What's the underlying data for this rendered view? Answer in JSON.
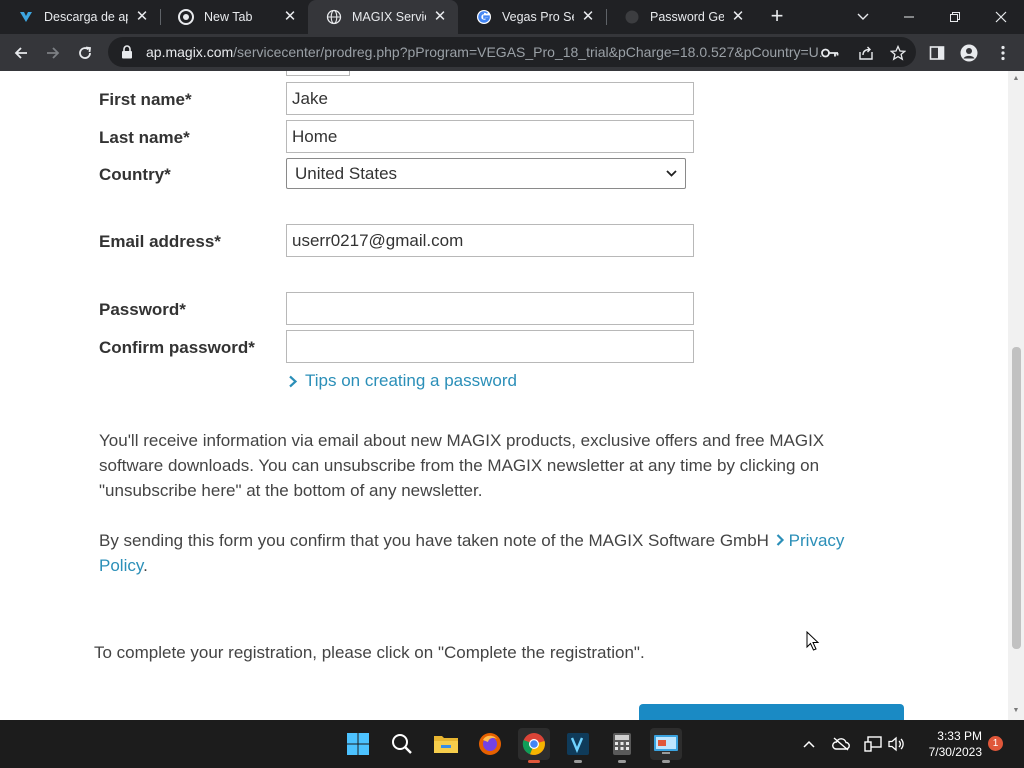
{
  "browser": {
    "tabs": [
      {
        "title": "Descarga de app",
        "favicon": "download-favicon",
        "active": false
      },
      {
        "title": "New Tab",
        "favicon": "chrome-favicon",
        "active": false
      },
      {
        "title": "MAGIX Service C",
        "favicon": "globe-favicon",
        "active": true
      },
      {
        "title": "Vegas Pro Serial",
        "favicon": "google-favicon",
        "active": false
      },
      {
        "title": "Password Gener",
        "favicon": "generic-favicon",
        "active": false
      }
    ],
    "url_host": "ap.magix.com",
    "url_path": "/servicecenter/prodreg.php?pProgram=VEGAS_Pro_18_trial&pCharge=18.0.527&pCountry=U..."
  },
  "form": {
    "first_name_label": "First name*",
    "first_name_value": "Jake",
    "last_name_label": "Last name*",
    "last_name_value": "Home",
    "country_label": "Country*",
    "country_value": "United States",
    "email_label": "Email address*",
    "email_value": "userr0217@gmail.com",
    "password_label": "Password*",
    "password_value": "",
    "confirm_password_label": "Confirm password*",
    "confirm_password_value": "",
    "tips_link": "Tips on creating a password"
  },
  "content": {
    "newsletter_text": "You'll receive information via email about new MAGIX products, exclusive offers and free MAGIX software downloads. You can unsubscribe from the MAGIX newsletter at any time by clicking on \"unsubscribe here\" at the bottom of any newsletter.",
    "privacy_text": "By sending this form you confirm that you have taken note of the MAGIX Software GmbH",
    "privacy_link": "Privacy Policy",
    "privacy_period": ".",
    "complete_text": "To complete your registration, please click on \"Complete the registration\"."
  },
  "taskbar": {
    "apps": [
      "windows-start-icon",
      "search-icon",
      "file-explorer-icon",
      "firefox-icon",
      "chrome-icon",
      "vegas-pro-icon",
      "calculator-icon",
      "control-panel-icon"
    ],
    "time": "3:33 PM",
    "date": "7/30/2023",
    "notification_count": "1"
  },
  "colors": {
    "link": "#2b8fb8",
    "button": "#1a8ac4",
    "browser_frame": "#202124"
  }
}
